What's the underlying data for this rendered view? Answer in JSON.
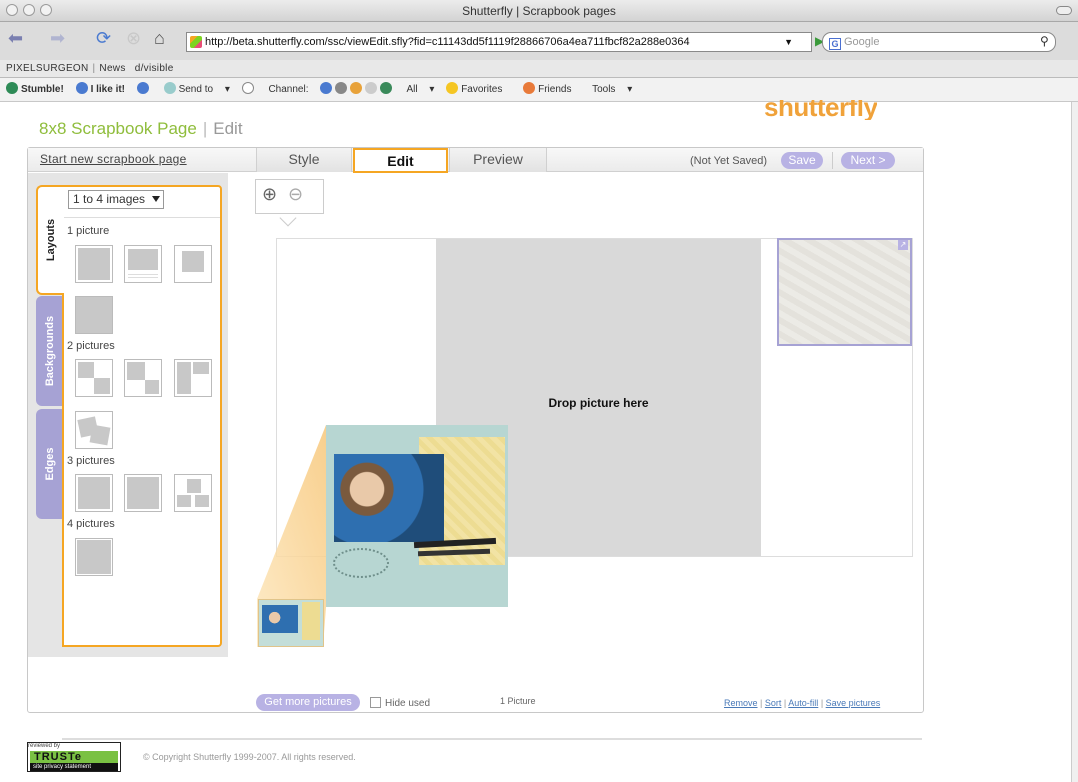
{
  "window": {
    "title": "Shutterfly | Scrapbook pages"
  },
  "toolbar": {
    "url": "http://beta.shutterfly.com/ssc/viewEdit.sfly?fid=c11143dd5f1119f28866706a4ea711fbcf82a288e0364",
    "search_placeholder": "Google"
  },
  "bookmarks": {
    "item1": "PIXELSURGEON",
    "item2": "News",
    "item3": "d/visible"
  },
  "stumblebar": {
    "stumble": "Stumble!",
    "ilike": "I like it!",
    "sendto": "Send to",
    "channel": "Channel:",
    "all": "All",
    "favorites": "Favorites",
    "friends": "Friends",
    "tools": "Tools"
  },
  "page": {
    "brand": "shutterfly",
    "title": "8x8 Scrapbook Page",
    "title_sep": "|",
    "title_edit": "Edit"
  },
  "header": {
    "start_new": "Start new scrapbook page",
    "tabs": {
      "style": "Style",
      "edit": "Edit",
      "preview": "Preview"
    },
    "status": "(Not Yet Saved)",
    "save": "Save",
    "next": "Next >"
  },
  "sidebar": {
    "tabs": {
      "layouts": "Layouts",
      "backgrounds": "Backgrounds",
      "edges": "Edges"
    },
    "image_count_selected": "1 to 4 images",
    "groups": [
      "1 picture",
      "2 pictures",
      "3 pictures",
      "4 pictures"
    ]
  },
  "canvas": {
    "drop_text": "Drop picture here"
  },
  "tray": {
    "get_more": "Get more pictures",
    "hide_used": "Hide used",
    "count": "1 Picture",
    "links": {
      "remove": "Remove",
      "sort": "Sort",
      "autofill": "Auto-fill",
      "save": "Save pictures"
    },
    "link_sep": "|"
  },
  "footer": {
    "truste_top": "reviewed by",
    "truste": "TRUSTe",
    "truste_sub": "site privacy statement",
    "copyright": "© Copyright Shutterfly 1999-2007. All rights reserved."
  },
  "colors": {
    "accent_orange": "#f5a623",
    "pill_purple": "#b8b2e4",
    "brand_green": "#8fbd3c"
  }
}
